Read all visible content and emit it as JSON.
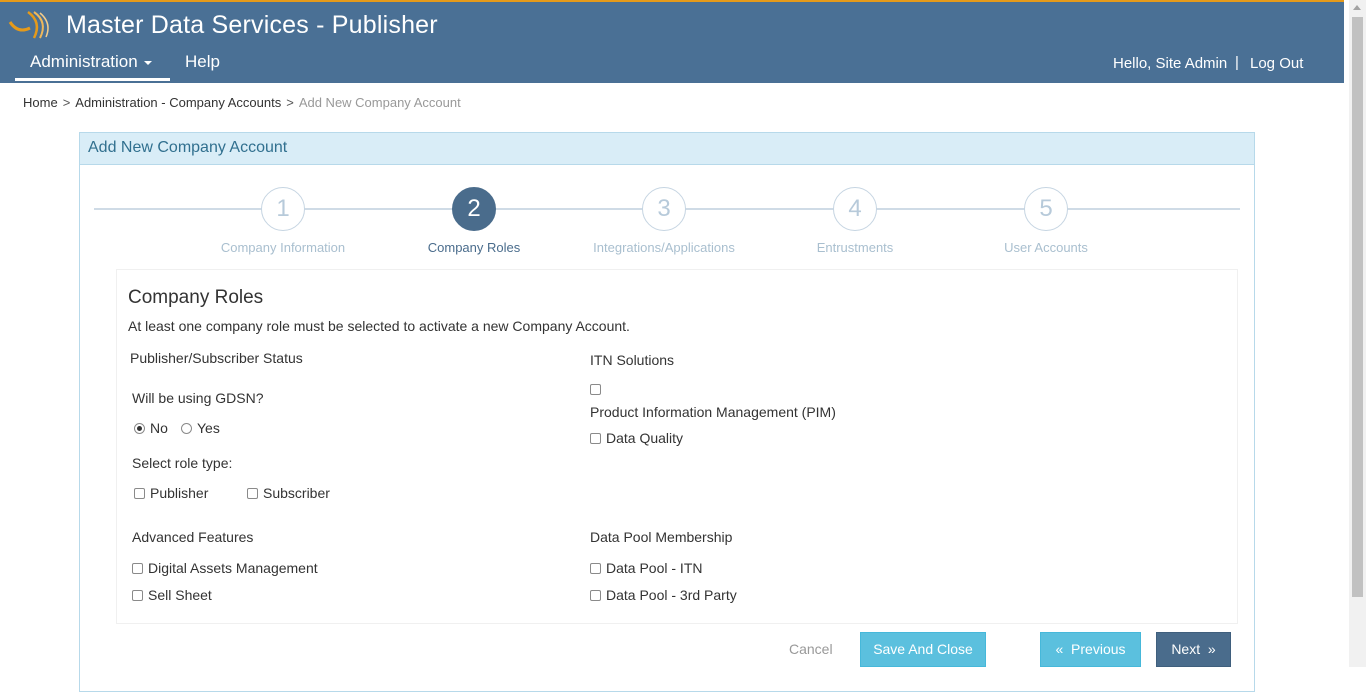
{
  "header": {
    "app_title": "Master Data Services - Publisher",
    "nav": {
      "administration": "Administration",
      "help": "Help"
    },
    "greeting": "Hello, Site Admin",
    "separator": "|",
    "logout": "Log Out",
    "colors": {
      "bar": "#4a7095",
      "accent": "#e59a1a"
    }
  },
  "breadcrumb": {
    "home": "Home",
    "accounts": "Administration - Company Accounts",
    "current": "Add New Company Account",
    "separator": ">"
  },
  "panel": {
    "title": "Add New Company Account"
  },
  "steps": [
    {
      "number": "1",
      "label": "Company Information",
      "active": false
    },
    {
      "number": "2",
      "label": "Company Roles",
      "active": true
    },
    {
      "number": "3",
      "label": "Integrations/Applications",
      "active": false
    },
    {
      "number": "4",
      "label": "Entrustments",
      "active": false
    },
    {
      "number": "5",
      "label": "User Accounts",
      "active": false
    }
  ],
  "roles": {
    "title": "Company Roles",
    "description": "At least one company role must be selected to activate a new Company Account.",
    "pub_sub": {
      "heading": "Publisher/Subscriber Status",
      "gdsn_question": "Will be using GDSN?",
      "gdsn_no": "No",
      "gdsn_yes": "Yes",
      "gdsn_selected": "No",
      "role_type_label": "Select role type:",
      "publisher": "Publisher",
      "subscriber": "Subscriber"
    },
    "itn": {
      "heading": "ITN Solutions",
      "pim": "Product Information Management (PIM)",
      "data_quality": "Data Quality"
    },
    "advanced": {
      "heading": "Advanced Features",
      "dam": "Digital Assets Management",
      "sell_sheet": "Sell Sheet"
    },
    "data_pool": {
      "heading": "Data Pool Membership",
      "itn": "Data Pool - ITN",
      "third_party": "Data Pool - 3rd Party"
    }
  },
  "actions": {
    "cancel": "Cancel",
    "save_close": "Save And Close",
    "previous": "Previous",
    "next": "Next",
    "colors": {
      "info": "#5bc0de",
      "primary": "#4a6c8c"
    }
  }
}
